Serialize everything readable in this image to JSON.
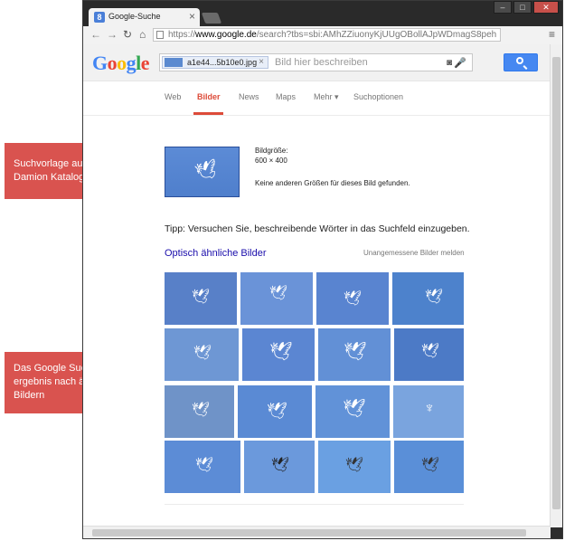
{
  "browser": {
    "tab_title": "Google-Suche",
    "favicon": "8",
    "url_prefix": "https://",
    "url_domain": "www.google.de",
    "url_rest": "/search?tbs=sbi:AMhZZiuonyKjUUgOBollAJpWDmagS8peh"
  },
  "google": {
    "logo": [
      "G",
      "o",
      "o",
      "g",
      "l",
      "e"
    ],
    "logo_colors": [
      "#4285f4",
      "#ea4335",
      "#fbbc05",
      "#4285f4",
      "#34a853",
      "#ea4335"
    ],
    "chip_label": "a1e44...5b10e0.jpg",
    "search_placeholder": "Bild hier beschreiben",
    "tabs": [
      "Web",
      "Bilder",
      "News",
      "Maps",
      "Mehr ▾",
      "Suchoptionen"
    ],
    "active_tab": "Bilder"
  },
  "result": {
    "size_label": "Bildgröße:",
    "size_value": "600 × 400",
    "no_other_sizes": "Keine anderen Größen für dieses Bild gefunden.",
    "tip": "Tipp: Versuchen Sie, beschreibende Wörter in das Suchfeld einzugeben.",
    "similar_link": "Optisch ähnliche Bilder",
    "report_link": "Unangemessene Bilder melden"
  },
  "callouts": {
    "top": [
      "Suchvorlage aus dem",
      "Damion Katalog"
    ],
    "bottom": [
      "Das Google Such-",
      "ergebnis nach ähnlichen",
      "Bildern"
    ]
  },
  "colors": {
    "accent_red": "#dd4b39",
    "callout": "#d9534f",
    "link_blue": "#1a0dab",
    "search_blue": "#4688f1"
  },
  "icons": {
    "back": "←",
    "forward": "→",
    "reload": "↻",
    "home": "⌂",
    "menu": "≡",
    "camera": "📷",
    "mic": "🎙",
    "bird": "🕊"
  }
}
